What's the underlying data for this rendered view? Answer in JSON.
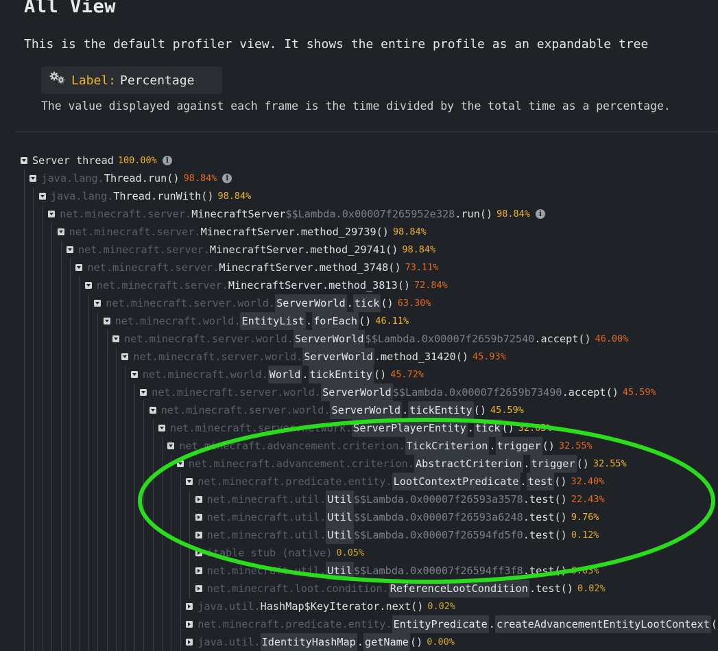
{
  "page": {
    "title": "All View",
    "intro": "This is the default profiler view. It shows the entire profile as an expandable tree",
    "setting": {
      "icon": "gears-icon",
      "label": "Label:",
      "value": "Percentage"
    },
    "setting_description": "The value displayed against each frame is the time divided by the total time as a percentage."
  },
  "colors": {
    "pct_high": "#e26a1e",
    "pct_mid": "#f0b429",
    "pct_low": "#d4a830",
    "annotation": "#2bdc1c"
  },
  "tree": [
    {
      "depth": 0,
      "expanded": true,
      "parts": [
        [
          "name",
          "Server thread"
        ]
      ],
      "pct": "100.00%",
      "pct_color": "#f0b429",
      "info": true
    },
    {
      "depth": 1,
      "expanded": true,
      "parts": [
        [
          "pkg",
          "java.lang."
        ],
        [
          "name",
          "Thread.run()"
        ]
      ],
      "pct": "98.84%",
      "pct_color": "#e26a1e",
      "info": true
    },
    {
      "depth": 2,
      "expanded": true,
      "parts": [
        [
          "pkg",
          "java.lang."
        ],
        [
          "name",
          "Thread.runWith()"
        ]
      ],
      "pct": "98.84%",
      "pct_color": "#f0b429"
    },
    {
      "depth": 3,
      "expanded": true,
      "parts": [
        [
          "pkg",
          "net.minecraft.server."
        ],
        [
          "name",
          "MinecraftServer"
        ],
        [
          "lam",
          "$$Lambda.0x00007f265952e328"
        ],
        [
          "name",
          ".run()"
        ]
      ],
      "pct": "98.84%",
      "pct_color": "#f0b429",
      "info": true
    },
    {
      "depth": 4,
      "expanded": true,
      "parts": [
        [
          "pkg",
          "net.minecraft.server."
        ],
        [
          "name",
          "MinecraftServer.method_29739()"
        ]
      ],
      "pct": "98.84%",
      "pct_color": "#f0b429"
    },
    {
      "depth": 5,
      "expanded": true,
      "parts": [
        [
          "pkg",
          "net.minecraft.server."
        ],
        [
          "name",
          "MinecraftServer.method_29741()"
        ]
      ],
      "pct": "98.84%",
      "pct_color": "#f0b429"
    },
    {
      "depth": 6,
      "expanded": true,
      "parts": [
        [
          "pkg",
          "net.minecraft.server."
        ],
        [
          "name",
          "MinecraftServer.method_3748()"
        ]
      ],
      "pct": "73.11%",
      "pct_color": "#e26a1e"
    },
    {
      "depth": 7,
      "expanded": true,
      "parts": [
        [
          "pkg",
          "net.minecraft.server."
        ],
        [
          "name",
          "MinecraftServer.method_3813()"
        ]
      ],
      "pct": "72.84%",
      "pct_color": "#e26a1e"
    },
    {
      "depth": 8,
      "expanded": true,
      "parts": [
        [
          "pkg",
          "net.minecraft.server.world."
        ],
        [
          "hl",
          "ServerWorld"
        ],
        [
          "name",
          "."
        ],
        [
          "hl",
          "tick"
        ],
        [
          "name",
          "()"
        ]
      ],
      "pct": "63.30%",
      "pct_color": "#e26a1e"
    },
    {
      "depth": 9,
      "expanded": true,
      "parts": [
        [
          "pkg",
          "net.minecraft.world."
        ],
        [
          "hl",
          "EntityList"
        ],
        [
          "name",
          "."
        ],
        [
          "hl",
          "forEach"
        ],
        [
          "name",
          "()"
        ]
      ],
      "pct": "46.11%",
      "pct_color": "#f0b429"
    },
    {
      "depth": 10,
      "expanded": true,
      "parts": [
        [
          "pkg",
          "net.minecraft.server.world."
        ],
        [
          "hl",
          "ServerWorld"
        ],
        [
          "lam",
          "$$Lambda.0x00007f2659b72540"
        ],
        [
          "name",
          ".accept()"
        ]
      ],
      "pct": "46.00%",
      "pct_color": "#e26a1e"
    },
    {
      "depth": 11,
      "expanded": true,
      "parts": [
        [
          "pkg",
          "net.minecraft.server.world."
        ],
        [
          "hl",
          "ServerWorld"
        ],
        [
          "name",
          ".method_31420()"
        ]
      ],
      "pct": "45.93%",
      "pct_color": "#e26a1e"
    },
    {
      "depth": 12,
      "expanded": true,
      "parts": [
        [
          "pkg",
          "net.minecraft.world."
        ],
        [
          "hl",
          "World"
        ],
        [
          "name",
          "."
        ],
        [
          "hl",
          "tickEntity"
        ],
        [
          "name",
          "()"
        ]
      ],
      "pct": "45.72%",
      "pct_color": "#e26a1e"
    },
    {
      "depth": 13,
      "expanded": true,
      "parts": [
        [
          "pkg",
          "net.minecraft.server.world."
        ],
        [
          "hl",
          "ServerWorld"
        ],
        [
          "lam",
          "$$Lambda.0x00007f2659b73490"
        ],
        [
          "name",
          ".accept()"
        ]
      ],
      "pct": "45.59%",
      "pct_color": "#e26a1e"
    },
    {
      "depth": 14,
      "expanded": true,
      "parts": [
        [
          "pkg",
          "net.minecraft.server.world."
        ],
        [
          "hl",
          "ServerWorld"
        ],
        [
          "name",
          "."
        ],
        [
          "hl",
          "tickEntity"
        ],
        [
          "name",
          "()"
        ]
      ],
      "pct": "45.59%",
      "pct_color": "#f0b429"
    },
    {
      "depth": 15,
      "expanded": true,
      "parts": [
        [
          "pkg",
          "net.minecraft.server.network."
        ],
        [
          "hl",
          "ServerPlayerEntity"
        ],
        [
          "name",
          "."
        ],
        [
          "hl",
          "tick"
        ],
        [
          "name",
          "()"
        ]
      ],
      "pct": "32.63%",
      "pct_color": "#f0b429"
    },
    {
      "depth": 16,
      "expanded": true,
      "parts": [
        [
          "pkg",
          "net.minecraft.advancement.criterion."
        ],
        [
          "hl",
          "TickCriterion"
        ],
        [
          "name",
          "."
        ],
        [
          "hl",
          "trigger"
        ],
        [
          "name",
          "()"
        ]
      ],
      "pct": "32.55%",
      "pct_color": "#e26a1e"
    },
    {
      "depth": 17,
      "expanded": true,
      "parts": [
        [
          "pkg",
          "net.minecraft.advancement.criterion."
        ],
        [
          "hl",
          "AbstractCriterion"
        ],
        [
          "name",
          "."
        ],
        [
          "hl",
          "trigger"
        ],
        [
          "name",
          "()"
        ]
      ],
      "pct": "32.55%",
      "pct_color": "#f0b429"
    },
    {
      "depth": 18,
      "expanded": true,
      "parts": [
        [
          "pkg",
          "net.minecraft.predicate.entity."
        ],
        [
          "hl",
          "LootContextPredicate"
        ],
        [
          "name",
          "."
        ],
        [
          "hl",
          "test"
        ],
        [
          "name",
          "()"
        ]
      ],
      "pct": "32.40%",
      "pct_color": "#e26a1e"
    },
    {
      "depth": 19,
      "expanded": false,
      "parts": [
        [
          "pkg",
          "net.minecraft.util."
        ],
        [
          "hl",
          "Util"
        ],
        [
          "lam",
          "$$Lambda.0x00007f26593a3578"
        ],
        [
          "name",
          ".test()"
        ]
      ],
      "pct": "22.43%",
      "pct_color": "#e26a1e"
    },
    {
      "depth": 19,
      "expanded": false,
      "parts": [
        [
          "pkg",
          "net.minecraft.util."
        ],
        [
          "hl",
          "Util"
        ],
        [
          "lam",
          "$$Lambda.0x00007f26593a6248"
        ],
        [
          "name",
          ".test()"
        ]
      ],
      "pct": "9.76%",
      "pct_color": "#f0b429"
    },
    {
      "depth": 19,
      "expanded": false,
      "parts": [
        [
          "pkg",
          "net.minecraft.util."
        ],
        [
          "hl",
          "Util"
        ],
        [
          "lam",
          "$$Lambda.0x00007f26594fd5f0"
        ],
        [
          "name",
          ".test()"
        ]
      ],
      "pct": "0.12%",
      "pct_color": "#d4a830"
    },
    {
      "depth": 19,
      "expanded": false,
      "parts": [
        [
          "pkg",
          "itable stub (native)"
        ]
      ],
      "pct": "0.05%",
      "pct_color": "#d4a830"
    },
    {
      "depth": 19,
      "expanded": false,
      "parts": [
        [
          "pkg",
          "net.minecraft.util."
        ],
        [
          "hl",
          "Util"
        ],
        [
          "lam",
          "$$Lambda.0x00007f26594ff3f8"
        ],
        [
          "name",
          ".test()"
        ]
      ],
      "pct": "0.03%",
      "pct_color": "#d4a830"
    },
    {
      "depth": 19,
      "expanded": false,
      "parts": [
        [
          "pkg",
          "net.minecraft.loot.condition."
        ],
        [
          "hl",
          "ReferenceLootCondition"
        ],
        [
          "name",
          ".test()"
        ]
      ],
      "pct": "0.02%",
      "pct_color": "#d4a830"
    },
    {
      "depth": 18,
      "expanded": false,
      "parts": [
        [
          "pkg",
          "java.util."
        ],
        [
          "name",
          "HashMap$KeyIterator.next()"
        ]
      ],
      "pct": "0.02%",
      "pct_color": "#d4a830"
    },
    {
      "depth": 18,
      "expanded": false,
      "parts": [
        [
          "pkg",
          "net.minecraft.predicate.entity."
        ],
        [
          "hl",
          "EntityPredicate"
        ],
        [
          "name",
          "."
        ],
        [
          "hl",
          "createAdvancementEntityLootContext"
        ],
        [
          "name",
          "()"
        ]
      ],
      "pct": "",
      "pct_color": "#d4a830"
    },
    {
      "depth": 18,
      "expanded": false,
      "parts": [
        [
          "pkg",
          "java.util."
        ],
        [
          "hl",
          "IdentityHashMap"
        ],
        [
          "name",
          "."
        ],
        [
          "hl",
          "getName"
        ],
        [
          "name",
          "()"
        ]
      ],
      "pct": "0.00%",
      "pct_color": "#d4a830"
    }
  ]
}
